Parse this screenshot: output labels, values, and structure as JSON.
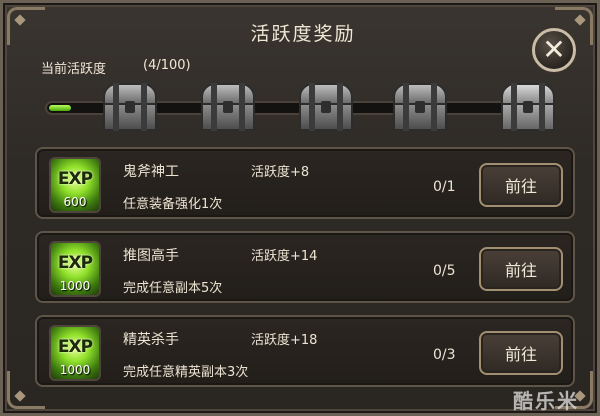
{
  "window": {
    "title": "活跃度奖励"
  },
  "activity": {
    "label": "当前活跃度",
    "progress_text": "(4/100)",
    "progress_value": 4,
    "progress_max": 100
  },
  "chests": [
    {
      "name": "chest-1"
    },
    {
      "name": "chest-2"
    },
    {
      "name": "chest-3"
    },
    {
      "name": "chest-4"
    },
    {
      "name": "chest-5"
    }
  ],
  "tasks": [
    {
      "exp_label": "EXP",
      "exp_amount": "600",
      "name": "鬼斧神工",
      "reward": "活跃度+8",
      "desc": "任意装备强化1次",
      "count": "0/1",
      "button": "前往"
    },
    {
      "exp_label": "EXP",
      "exp_amount": "1000",
      "name": "推图高手",
      "reward": "活跃度+14",
      "desc": "完成任意副本5次",
      "count": "0/5",
      "button": "前往"
    },
    {
      "exp_label": "EXP",
      "exp_amount": "1000",
      "name": "精英杀手",
      "reward": "活跃度+18",
      "desc": "完成任意精英副本3次",
      "count": "0/3",
      "button": "前往"
    }
  ],
  "watermark": "酷乐米",
  "colors": {
    "accent_green": "#8fe02a",
    "frame": "#6b6155"
  }
}
